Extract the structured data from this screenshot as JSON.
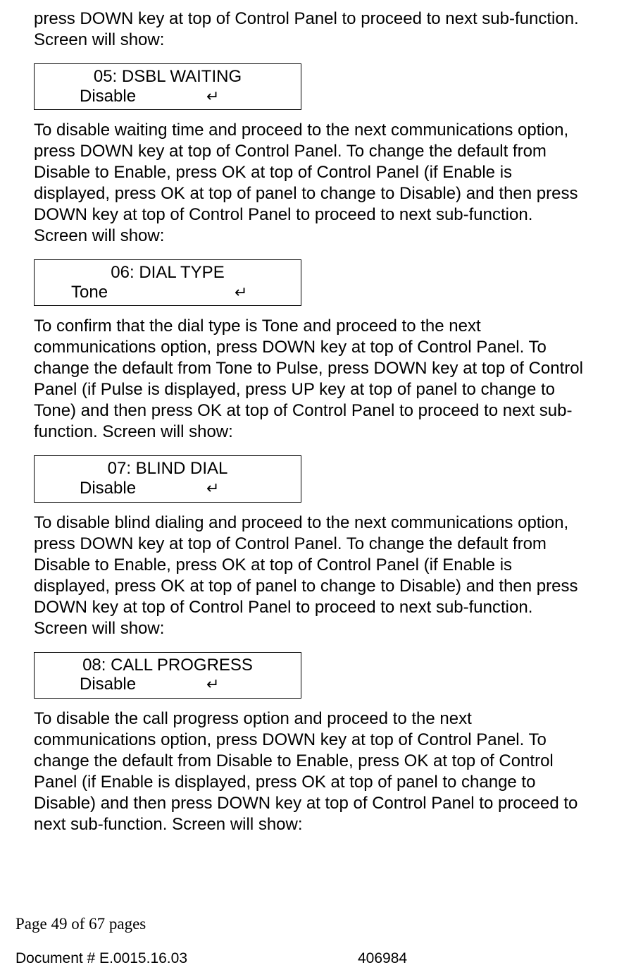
{
  "para_intro": "press DOWN key at top of Control Panel to proceed to next sub-function. Screen will show:",
  "screens": [
    {
      "title": "05: DSBL WAITING",
      "value": "Disable",
      "enter": "↵",
      "enterClass": "enter-offset-a",
      "valueClass": "screen-value"
    },
    {
      "title": "06: DIAL TYPE",
      "value": "Tone",
      "enter": "↵",
      "enterClass": "enter-offset-b",
      "valueClass": "screen-value-wide"
    },
    {
      "title": "07: BLIND DIAL",
      "value": "Disable",
      "enter": "↵",
      "enterClass": "enter-offset-a",
      "valueClass": "screen-value"
    },
    {
      "title": "08: CALL PROGRESS",
      "value": "Disable",
      "enter": "↵",
      "enterClass": "enter-offset-a",
      "valueClass": "screen-value"
    }
  ],
  "paras": [
    "To disable waiting time and proceed to the next communications option, press DOWN key at top of Control Panel. To change the default from Disable to Enable, press OK at top of Control Panel (if Enable is displayed, press OK at top of panel to change to Disable) and then press DOWN key at top of Control Panel to proceed to next sub-function. Screen will show:",
    "To confirm that the dial type is Tone and proceed to the next communications option, press DOWN key at top of Control Panel. To change the default from Tone to Pulse, press DOWN key at top of Control Panel (if Pulse is displayed, press UP key at top of panel to change to Tone) and then press OK at top of Control Panel to proceed to next sub-function. Screen will show:",
    "To disable blind dialing and proceed to the next communications option, press DOWN key at top of Control Panel. To change the default from Disable to Enable, press OK at top of Control Panel (if Enable is displayed, press OK at top of panel to change to Disable) and then press DOWN key at top of Control Panel to proceed to next sub-function. Screen will show:",
    "To disable the call progress option and proceed to the next communications option, press DOWN key at top of Control Panel. To change the default from Disable to Enable, press OK at top of Control Panel (if Enable is displayed, press OK at top of panel to change to Disable) and then press DOWN key at top of Control Panel to proceed to next sub-function. Screen will show:"
  ],
  "footer": {
    "page": "Page 49 of  67 pages",
    "doc": "Document # E.0015.16.03",
    "num": "406984"
  }
}
